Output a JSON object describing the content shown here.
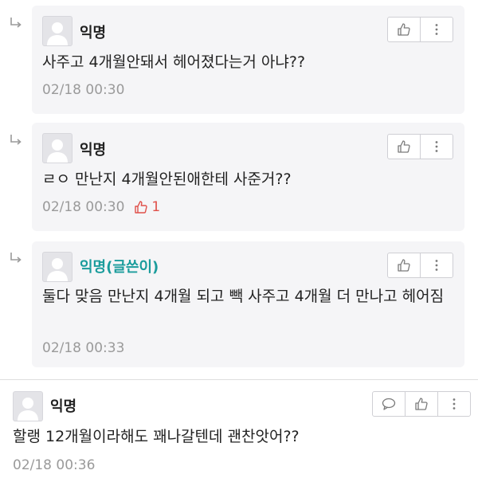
{
  "comments": [
    {
      "author": "익명",
      "text": "사주고 4개월안돼서 헤어졌다는거 아냐??",
      "time": "02/18 00:30",
      "likes": ""
    },
    {
      "author": "익명",
      "text": "ㄹㅇ 만난지 4개월안된애한테 사준거??",
      "time": "02/18 00:30",
      "likes": "1"
    },
    {
      "author": "익명(글쓴이)",
      "text": "둘다 맞음 만난지 4개월 되고 빽 사주고 4개월 더 만나고 헤어짐",
      "time": "02/18 00:33",
      "likes": ""
    },
    {
      "author": "익명",
      "text": "할랭 12개월이라해도 꽤나갈텐데 괜찬앗어??",
      "time": "02/18 00:36",
      "likes": ""
    }
  ],
  "icons": {
    "reply": "reply-arrow-icon",
    "like": "thumbs-up-icon",
    "more": "more-vertical-icon",
    "comment": "speech-bubble-icon",
    "avatar": "default-avatar-icon"
  },
  "colors": {
    "op_author": "#1a9c9c",
    "like_count": "#e0504a",
    "card_bg": "#f5f5f7",
    "meta": "#9a9a9a"
  }
}
